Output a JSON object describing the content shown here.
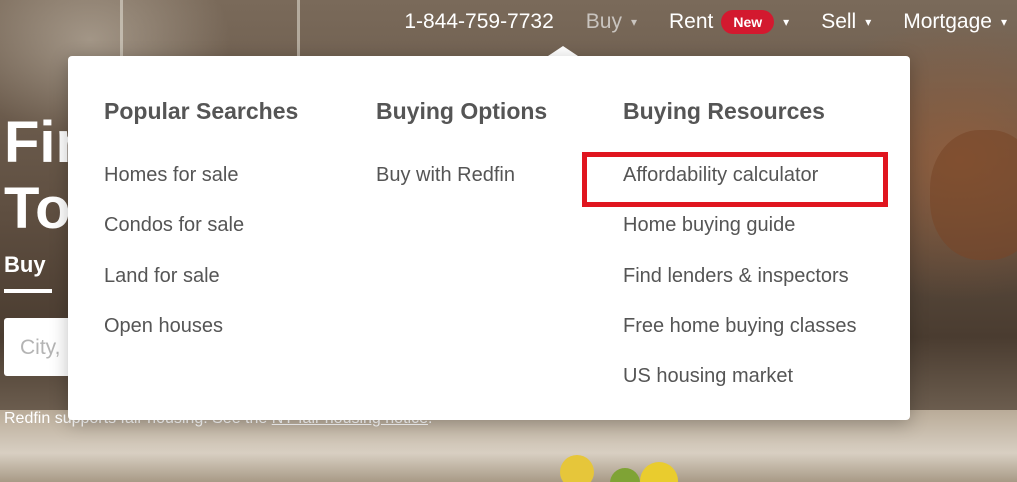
{
  "nav": {
    "phone": "1-844-759-7732",
    "buy": "Buy",
    "rent": "Rent",
    "rent_badge": "New",
    "sell": "Sell",
    "mortgage": "Mortgage",
    "caret": "▾"
  },
  "hero": {
    "title_line1": "Fin",
    "title_line2": "To",
    "active_tab": "Buy",
    "search_placeholder": "City,",
    "fair_housing_text": "Redfin supports fair housing. See the ",
    "fair_housing_link": "NY fair housing notice",
    "fair_housing_end": "."
  },
  "dropdown": {
    "columns": [
      {
        "heading": "Popular Searches",
        "links": [
          "Homes for sale",
          "Condos for sale",
          "Land for sale",
          "Open houses"
        ]
      },
      {
        "heading": "Buying Options",
        "links": [
          "Buy with Redfin"
        ]
      },
      {
        "heading": "Buying Resources",
        "links": [
          "Affordability calculator",
          "Home buying guide",
          "Find lenders & inspectors",
          "Free home buying classes",
          "US housing market"
        ]
      }
    ],
    "highlighted_link": "Affordability calculator"
  },
  "colors": {
    "badge": "#d3192f",
    "highlight": "#e0151f",
    "menu_text": "#555555"
  }
}
